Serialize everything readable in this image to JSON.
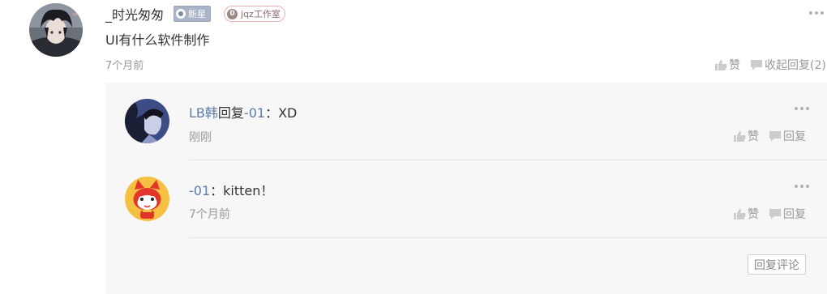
{
  "comment": {
    "author": "_时光匆匆",
    "badges": {
      "star_label": "新星",
      "studio_count": "0",
      "studio_label": "jqz工作室"
    },
    "text": "UI有什么软件制作",
    "time": "7个月前",
    "like_label": "赞",
    "collapse_label": "收起回复(2)"
  },
  "replies": [
    {
      "user": "LB韩",
      "reply_word": "回复",
      "target": "-01",
      "separator": "：",
      "text": "XD",
      "time": "刚刚",
      "like_label": "赞",
      "reply_label": "回复"
    },
    {
      "user": "",
      "reply_word": "",
      "target": "-01",
      "separator": "：",
      "text": "kitten！",
      "time": "7个月前",
      "like_label": "赞",
      "reply_label": "回复"
    }
  ],
  "reply_comment_button": "回复评论",
  "colors": {
    "link_blue": "#5c7ca6",
    "muted_gray": "#999999",
    "panel_bg": "#f7f7f7",
    "star_badge": "#a9b4c8"
  },
  "icons": {
    "like": "thumbs-up-icon",
    "reply": "speech-bubble-icon",
    "more": "more-dots-icon"
  }
}
